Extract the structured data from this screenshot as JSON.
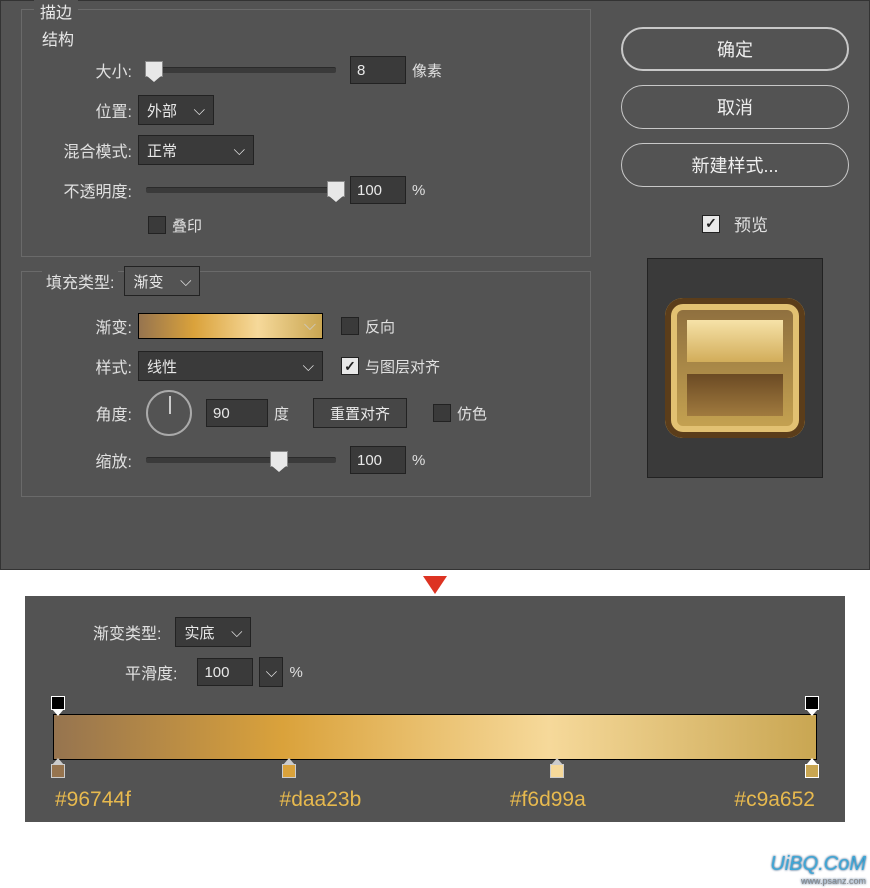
{
  "section_stroke": "描边",
  "section_structure": "结构",
  "labels": {
    "size": "大小:",
    "position": "位置:",
    "blend_mode": "混合模式:",
    "opacity": "不透明度:",
    "overprint": "叠印",
    "fill_type": "填充类型:",
    "gradient": "渐变:",
    "style": "样式:",
    "angle": "角度:",
    "scale": "缩放:",
    "reverse": "反向",
    "align_layer": "与图层对齐",
    "dither": "仿色",
    "degree_unit": "度",
    "pixel_unit": "像素",
    "percent_unit": "%",
    "reset_align": "重置对齐",
    "gradient_type": "渐变类型:",
    "smoothness": "平滑度:"
  },
  "values": {
    "size": "8",
    "position": "外部",
    "blend_mode": "正常",
    "opacity": "100",
    "fill_type": "渐变",
    "style": "线性",
    "angle": "90",
    "scale": "100",
    "gradient_type": "实底",
    "smoothness": "100",
    "align_layer_checked": true
  },
  "buttons": {
    "ok": "确定",
    "cancel": "取消",
    "new_style": "新建样式...",
    "preview": "预览"
  },
  "gradient_stops": {
    "colors": [
      "#96744f",
      "#daa23b",
      "#f6d99a",
      "#c9a652"
    ],
    "positions_pct": [
      0,
      30,
      65,
      100
    ]
  },
  "watermark": "UiBQ.CoM",
  "watermark_sub": "www.psanz.com"
}
